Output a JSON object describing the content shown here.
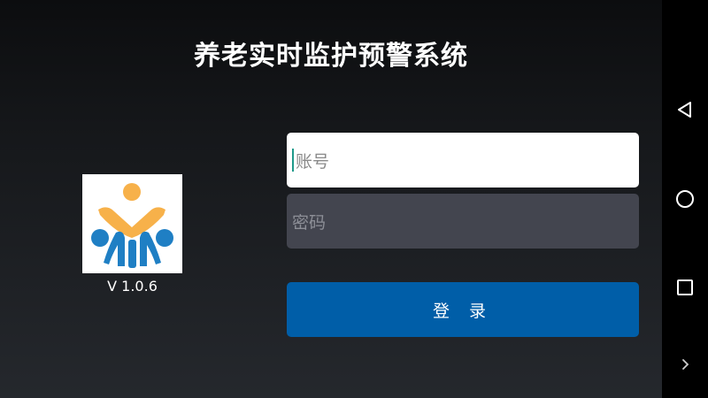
{
  "app": {
    "title": "养老实时监护预警系统",
    "version": "V 1.0.6",
    "logo_icon": "family-care-logo",
    "logo_colors": {
      "top": "#f7b14a",
      "bottom": "#1f7fc4"
    }
  },
  "form": {
    "account_placeholder": "账号",
    "password_placeholder": "密码",
    "login_label": "登 录"
  },
  "colors": {
    "login_button": "#005ea8",
    "password_field": "#43454f",
    "account_field": "#ffffff"
  },
  "nav": {
    "back_icon": "triangle-back-icon",
    "home_icon": "circle-home-icon",
    "recent_icon": "square-recent-icon",
    "more_icon": "chevron-right-icon"
  }
}
